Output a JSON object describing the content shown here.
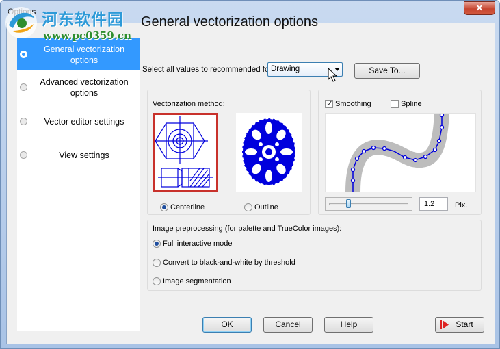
{
  "window": {
    "title": "Options",
    "close_label": "✕",
    "watermark_text": "河东软件园",
    "watermark_url": "www.pc0359.cn"
  },
  "sidebar": {
    "items": [
      {
        "label": "General vectorization options",
        "active": true
      },
      {
        "label": "Advanced vectorization options",
        "active": false
      },
      {
        "label": "Vector editor settings",
        "active": false
      },
      {
        "label": "View settings",
        "active": false
      }
    ]
  },
  "main": {
    "title": "General vectorization options",
    "preset_label": "Select all values to recommended for:",
    "preset_value": "Drawing",
    "save_to_label": "Save To..."
  },
  "vectorization": {
    "group_label": "Vectorization method:",
    "options": [
      {
        "label": "Centerline",
        "selected": true
      },
      {
        "label": "Outline",
        "selected": false
      }
    ]
  },
  "smoothing": {
    "smoothing_label": "Smoothing",
    "smoothing_checked": true,
    "spline_label": "Spline",
    "spline_checked": false,
    "slider_fraction": 0.22,
    "value": "1.2",
    "unit": "Pix."
  },
  "preprocessing": {
    "group_label": "Image preprocessing (for palette and TrueColor images):",
    "options": [
      {
        "label": "Full interactive mode",
        "selected": true
      },
      {
        "label": "Convert to black-and-white by threshold",
        "selected": false
      },
      {
        "label": "Image segmentation",
        "selected": false
      }
    ]
  },
  "footer": {
    "ok_label": "OK",
    "cancel_label": "Cancel",
    "help_label": "Help",
    "start_label": "Start"
  },
  "colors": {
    "accent": "#3399ff",
    "selection_border": "#c8312b",
    "drawing_blue": "#0000dd"
  }
}
